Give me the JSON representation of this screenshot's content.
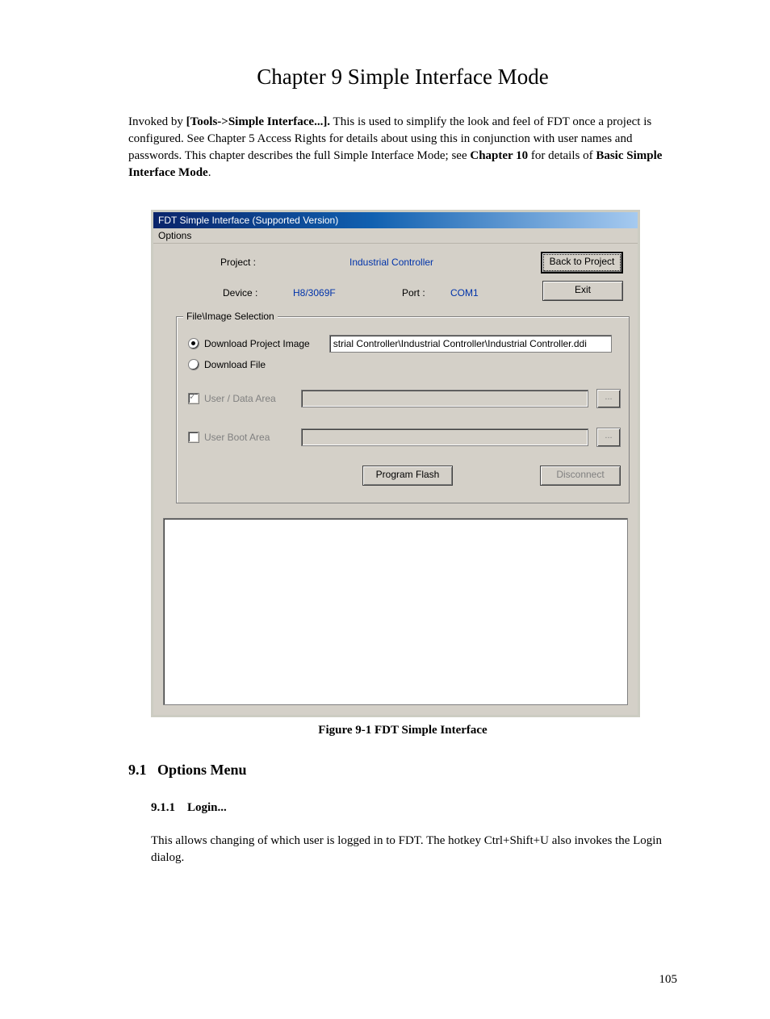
{
  "chapter_title": "Chapter 9   Simple Interface Mode",
  "intro": {
    "prefix": "Invoked by ",
    "tools": "[Tools",
    "arrow": "->Simple Interface...].",
    "rest1": " This is used to simplify the look and feel of FDT once a project is configured. See Chapter 5   Access Rights for details about using this in conjunction with user names and passwords. This chapter describes the full Simple Interface Mode; see ",
    "chap10": "Chapter 10",
    "rest2": "  for details of ",
    "basic": "Basic Simple Interface Mode",
    "period": "."
  },
  "dialog": {
    "title": "FDT Simple Interface   (Supported Version)",
    "menu": "Options",
    "labels": {
      "project": "Project :",
      "device": "Device :",
      "port": "Port :"
    },
    "values": {
      "project": "Industrial Controller",
      "device": "H8/3069F",
      "port": "COM1"
    },
    "buttons": {
      "back": "Back to Project",
      "exit": "Exit",
      "program": "Program Flash",
      "disconnect": "Disconnect",
      "ellipsis": "..."
    },
    "group": {
      "title": "File\\Image Selection",
      "radio_dpi": "Download Project Image",
      "radio_df": "Download File",
      "path": "strial Controller\\Industrial Controller\\Industrial Controller.ddi",
      "chk_user": "User / Data Area",
      "chk_boot": "User Boot Area"
    }
  },
  "figure_caption": "Figure 9-1 FDT Simple Interface",
  "section": {
    "num": "9.1",
    "title": "Options Menu"
  },
  "subsection": {
    "num": "9.1.1",
    "title": "Login..."
  },
  "subsection_body": "This allows changing of which user is logged in to FDT. The hotkey Ctrl+Shift+U also invokes the Login dialog.",
  "page_number": "105"
}
